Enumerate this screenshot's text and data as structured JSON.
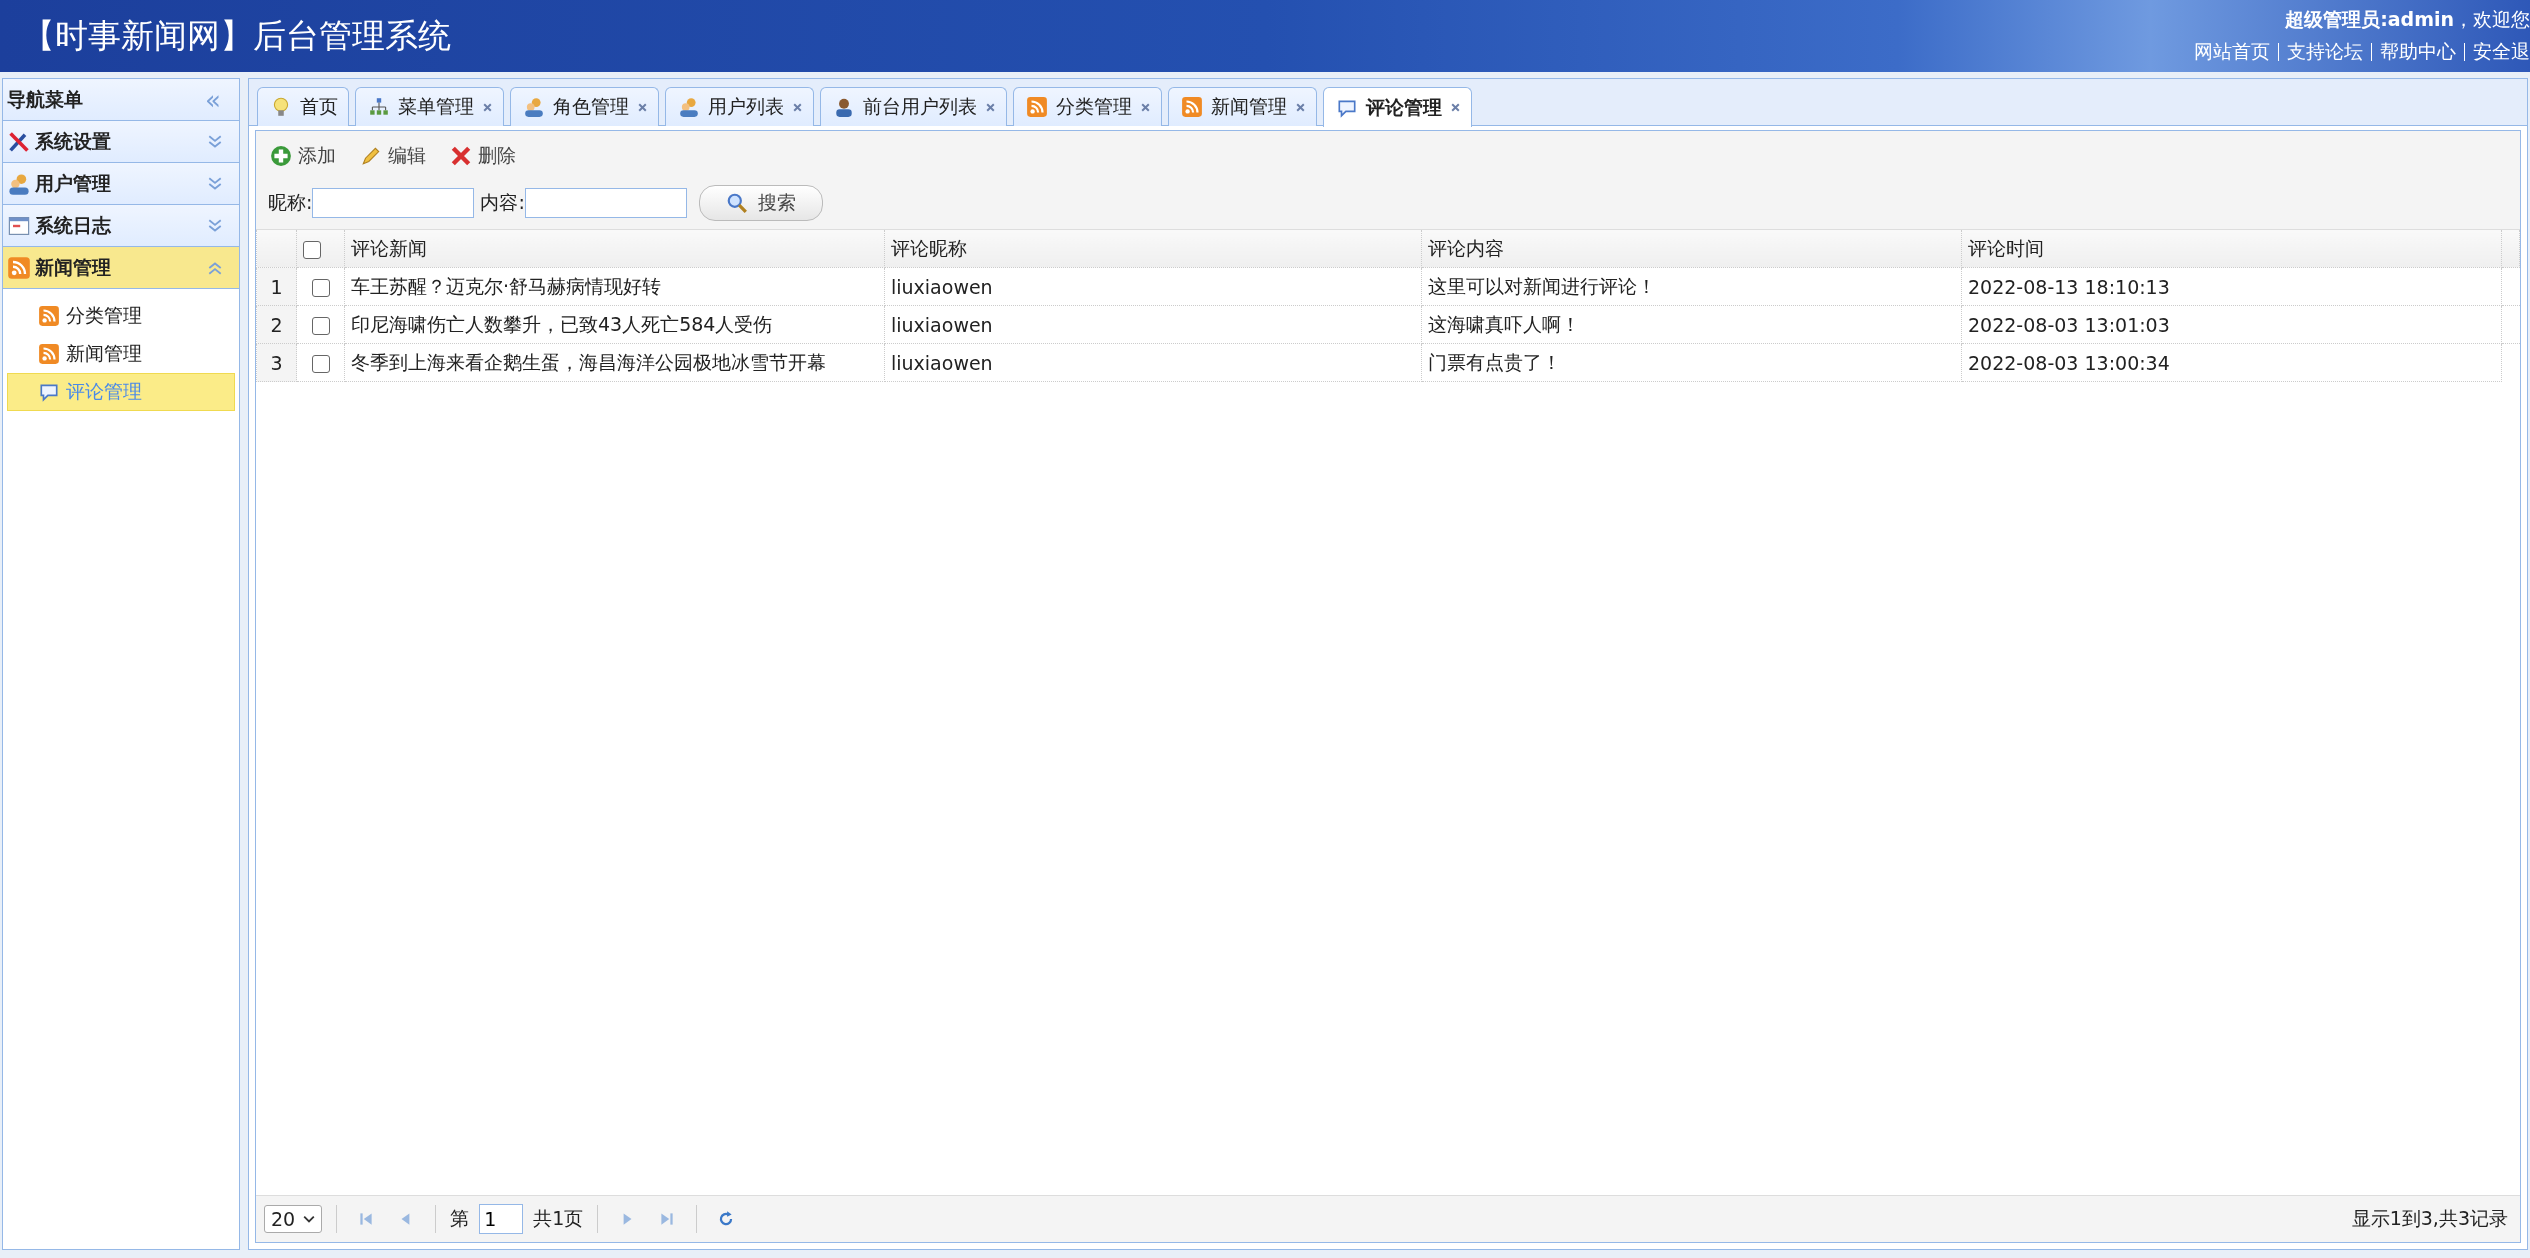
{
  "header": {
    "title": "【时事新闻网】后台管理系统",
    "user_label": "超级管理员:admin",
    "welcome": "，欢迎您",
    "links": [
      "网站首页",
      "支持论坛",
      "帮助中心",
      "安全退"
    ]
  },
  "sidebar": {
    "title": "导航菜单",
    "collapse_icon": "«",
    "groups": [
      {
        "label": "系统设置",
        "kind": "tools",
        "expanded": false
      },
      {
        "label": "用户管理",
        "kind": "users",
        "expanded": false
      },
      {
        "label": "系统日志",
        "kind": "log",
        "expanded": false
      },
      {
        "label": "新闻管理",
        "kind": "rss",
        "expanded": true,
        "children": [
          {
            "label": "分类管理",
            "kind": "rss",
            "selected": false
          },
          {
            "label": "新闻管理",
            "kind": "rss",
            "selected": false
          },
          {
            "label": "评论管理",
            "kind": "comment",
            "selected": true
          }
        ]
      }
    ]
  },
  "tabs": [
    {
      "label": "首页",
      "kind": "bulb",
      "closable": false,
      "selected": false
    },
    {
      "label": "菜单管理",
      "kind": "tree",
      "closable": true,
      "selected": false
    },
    {
      "label": "角色管理",
      "kind": "users",
      "closable": true,
      "selected": false
    },
    {
      "label": "用户列表",
      "kind": "users",
      "closable": true,
      "selected": false
    },
    {
      "label": "前台用户列表",
      "kind": "user",
      "closable": true,
      "selected": false
    },
    {
      "label": "分类管理",
      "kind": "rss",
      "closable": true,
      "selected": false
    },
    {
      "label": "新闻管理",
      "kind": "rss",
      "closable": true,
      "selected": false
    },
    {
      "label": "评论管理",
      "kind": "comment",
      "closable": true,
      "selected": true
    }
  ],
  "toolbar": [
    {
      "label": "添加",
      "kind": "add"
    },
    {
      "label": "编辑",
      "kind": "edit"
    },
    {
      "label": "删除",
      "kind": "delete"
    }
  ],
  "search": {
    "fields": [
      {
        "label": "昵称:"
      },
      {
        "label": "内容:"
      }
    ],
    "button": "搜索"
  },
  "table": {
    "columns": [
      "评论新闻",
      "评论昵称",
      "评论内容",
      "评论时间"
    ],
    "header_checked": false,
    "rows": [
      {
        "index": "1",
        "checked": false,
        "cells": [
          "车王苏醒？迈克尔·舒马赫病情现好转",
          "liuxiaowen",
          "这里可以对新闻进行评论！",
          "2022-08-13 18:10:13"
        ]
      },
      {
        "index": "2",
        "checked": false,
        "cells": [
          "印尼海啸伤亡人数攀升，已致43人死亡584人受伤",
          "liuxiaowen",
          "这海啸真吓人啊！",
          "2022-08-03 13:01:03"
        ]
      },
      {
        "index": "3",
        "checked": false,
        "cells": [
          "冬季到上海来看企鹅生蛋，海昌海洋公园极地冰雪节开幕",
          "liuxiaowen",
          "门票有点贵了！",
          "2022-08-03 13:00:34"
        ]
      }
    ]
  },
  "pager": {
    "page_size": "20",
    "page_prefix": "第",
    "page": "1",
    "page_total": "共1页",
    "summary": "显示1到3,共3记录"
  }
}
